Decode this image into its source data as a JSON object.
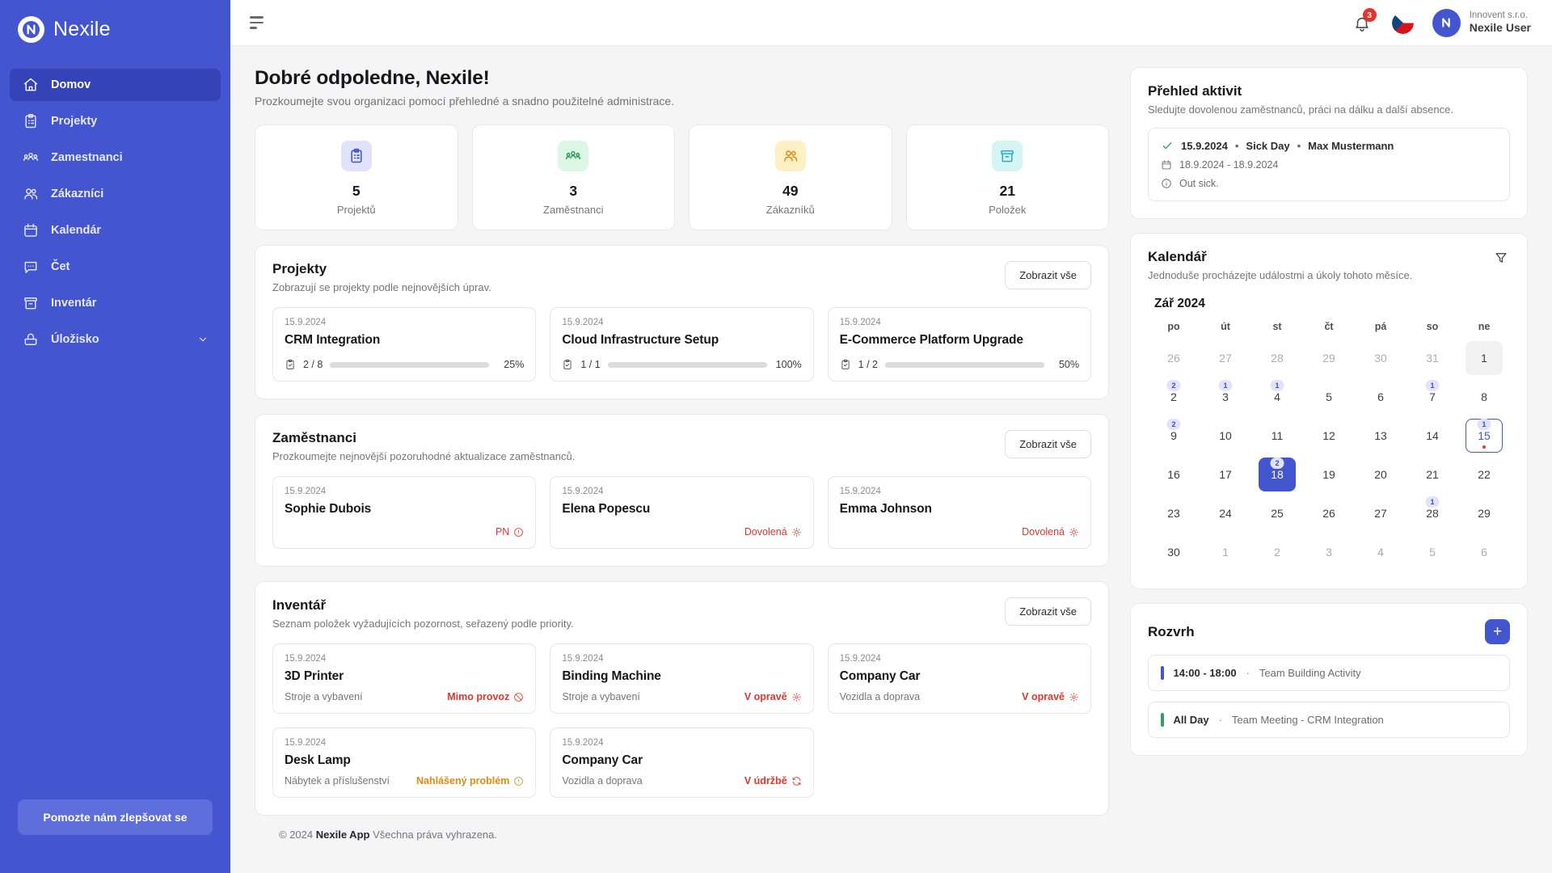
{
  "brand": {
    "name": "Nexile"
  },
  "sidebar": {
    "items": [
      {
        "label": "Domov",
        "icon": "home-icon",
        "active": true
      },
      {
        "label": "Projekty",
        "icon": "clipboard-icon",
        "active": false
      },
      {
        "label": "Zamestnanci",
        "icon": "users-group-icon",
        "active": false
      },
      {
        "label": "Zákazníci",
        "icon": "users-icon",
        "active": false
      },
      {
        "label": "Kalendár",
        "icon": "calendar-icon",
        "active": false
      },
      {
        "label": "Čet",
        "icon": "chat-icon",
        "active": false
      },
      {
        "label": "Inventár",
        "icon": "box-icon",
        "active": false
      },
      {
        "label": "Úložisko",
        "icon": "archive-icon",
        "active": false,
        "chevron": "chevron-down-icon"
      }
    ],
    "feedback_label": "Pomozte nám zlepšovat se"
  },
  "topbar": {
    "menu_icon": "hamburger-icon",
    "notification_icon": "bell-icon",
    "notification_count": "3",
    "language_icon": "czech-flag-icon",
    "user_org": "Innovent s.r.o.",
    "user_name": "Nexile User"
  },
  "header": {
    "greeting": "Dobré odpoledne, Nexile!",
    "subtitle": "Prozkoumejte svou organizaci pomocí přehledné a snadno použitelné administrace."
  },
  "stats": [
    {
      "value": "5",
      "label": "Projektů",
      "icon": "clipboard-icon",
      "bg": "#e0e3fb",
      "fg": "#3f51c9"
    },
    {
      "value": "3",
      "label": "Zaměstnanci",
      "icon": "users-group-icon",
      "bg": "#dcf7e6",
      "fg": "#2f9e5e"
    },
    {
      "value": "49",
      "label": "Zákazníků",
      "icon": "users-icon",
      "bg": "#fdf0c4",
      "fg": "#dd8b12"
    },
    {
      "value": "21",
      "label": "Položek",
      "icon": "box-icon",
      "bg": "#d4f5f3",
      "fg": "#2aa8c4"
    }
  ],
  "projects": {
    "title": "Projekty",
    "subtitle": "Zobrazují se projekty podle nejnovějších úprav.",
    "view_all": "Zobrazit vše",
    "items": [
      {
        "date": "15.9.2024",
        "name": "CRM Integration",
        "fraction": "2 / 8",
        "percent": "25%",
        "pct": 25,
        "color": "#e5342b"
      },
      {
        "date": "15.9.2024",
        "name": "Cloud Infrastructure Setup",
        "fraction": "1 / 1",
        "percent": "100%",
        "pct": 100,
        "color": "#2fa35c"
      },
      {
        "date": "15.9.2024",
        "name": "E-Commerce Platform Upgrade",
        "fraction": "1 / 2",
        "percent": "50%",
        "pct": 50,
        "color": "#4355cf"
      }
    ]
  },
  "employees": {
    "title": "Zaměstnanci",
    "subtitle": "Prozkoumejte nejnovější pozoruhodné aktualizace zaměstnanců.",
    "view_all": "Zobrazit vše",
    "items": [
      {
        "date": "15.9.2024",
        "name": "Sophie Dubois",
        "status": "PN",
        "icon": "alert-circle-icon",
        "color": "#e5342b"
      },
      {
        "date": "15.9.2024",
        "name": "Elena Popescu",
        "status": "Dovolená",
        "icon": "sun-icon",
        "color": "#e5342b"
      },
      {
        "date": "15.9.2024",
        "name": "Emma Johnson",
        "status": "Dovolená",
        "icon": "sun-icon",
        "color": "#e5342b"
      }
    ]
  },
  "inventory": {
    "title": "Inventář",
    "subtitle": "Seznam položek vyžadujících pozornost, seřazený podle priority.",
    "view_all": "Zobrazit vše",
    "items": [
      {
        "date": "15.9.2024",
        "name": "3D Printer",
        "category": "Stroje a vybavení",
        "status": "Mimo provoz",
        "icon": "ban-icon",
        "color": "#e5342b"
      },
      {
        "date": "15.9.2024",
        "name": "Binding Machine",
        "category": "Stroje a vybavení",
        "status": "V opravě",
        "icon": "gear-icon",
        "color": "#e5342b"
      },
      {
        "date": "15.9.2024",
        "name": "Company Car",
        "category": "Vozidla a doprava",
        "status": "V opravě",
        "icon": "gear-icon",
        "color": "#e5342b"
      },
      {
        "date": "15.9.2024",
        "name": "Desk Lamp",
        "category": "Nábytek a příslušenství",
        "status": "Nahlášený problém",
        "icon": "alert-circle-icon",
        "color": "#e08a14"
      },
      {
        "date": "15.9.2024",
        "name": "Company Car",
        "category": "Vozidla a doprava",
        "status": "V údržbě",
        "icon": "refresh-icon",
        "color": "#e5342b"
      }
    ]
  },
  "activity": {
    "title": "Přehled aktivit",
    "subtitle": "Sledujte dovolenou zaměstnanců, práci na dálku a další absence.",
    "item": {
      "check_icon": "check-icon",
      "date": "15.9.2024",
      "type": "Sick Day",
      "person": "Max Mustermann",
      "range_icon": "calendar-icon",
      "range": "18.9.2024 - 18.9.2024",
      "note_icon": "info-icon",
      "note": "Out sick."
    }
  },
  "calendar": {
    "title": "Kalendář",
    "subtitle": "Jednoduše procházejte událostmi a úkoly tohoto měsíce.",
    "filter_icon": "filter-icon",
    "month": "Zář 2024",
    "dow": [
      "po",
      "út",
      "st",
      "čt",
      "pá",
      "so",
      "ne"
    ],
    "days": [
      {
        "n": "26",
        "muted": true
      },
      {
        "n": "27",
        "muted": true
      },
      {
        "n": "28",
        "muted": true
      },
      {
        "n": "29",
        "muted": true
      },
      {
        "n": "30",
        "muted": true
      },
      {
        "n": "31",
        "muted": true
      },
      {
        "n": "1",
        "muted": false,
        "grey": true
      },
      {
        "n": "2",
        "badge": "2"
      },
      {
        "n": "3",
        "badge": "1"
      },
      {
        "n": "4",
        "badge": "1"
      },
      {
        "n": "5"
      },
      {
        "n": "6"
      },
      {
        "n": "7",
        "badge": "1"
      },
      {
        "n": "8"
      },
      {
        "n": "9",
        "badge": "2"
      },
      {
        "n": "10"
      },
      {
        "n": "11"
      },
      {
        "n": "12"
      },
      {
        "n": "13"
      },
      {
        "n": "14"
      },
      {
        "n": "15",
        "badge": "1",
        "today": true,
        "dot": true
      },
      {
        "n": "16"
      },
      {
        "n": "17"
      },
      {
        "n": "18",
        "badge": "2",
        "selected": true
      },
      {
        "n": "19"
      },
      {
        "n": "20"
      },
      {
        "n": "21"
      },
      {
        "n": "22"
      },
      {
        "n": "23"
      },
      {
        "n": "24"
      },
      {
        "n": "25"
      },
      {
        "n": "26"
      },
      {
        "n": "27"
      },
      {
        "n": "28",
        "badge": "1"
      },
      {
        "n": "29"
      },
      {
        "n": "30"
      },
      {
        "n": "1",
        "muted": true
      },
      {
        "n": "2",
        "muted": true
      },
      {
        "n": "3",
        "muted": true
      },
      {
        "n": "4",
        "muted": true
      },
      {
        "n": "5",
        "muted": true
      },
      {
        "n": "6",
        "muted": true
      }
    ]
  },
  "schedule": {
    "title": "Rozvrh",
    "add_icon": "plus-icon",
    "items": [
      {
        "time": "14:00 - 18:00",
        "sep": "·",
        "name": "Team Building Activity",
        "color": "#4355cf"
      },
      {
        "time": "All Day",
        "sep": "·",
        "name": "Team Meeting - CRM Integration",
        "color": "#2fa35c"
      }
    ]
  },
  "footer": {
    "copyright": "© 2024",
    "app": "Nexile App",
    "rights": "Všechna práva vyhrazena."
  }
}
